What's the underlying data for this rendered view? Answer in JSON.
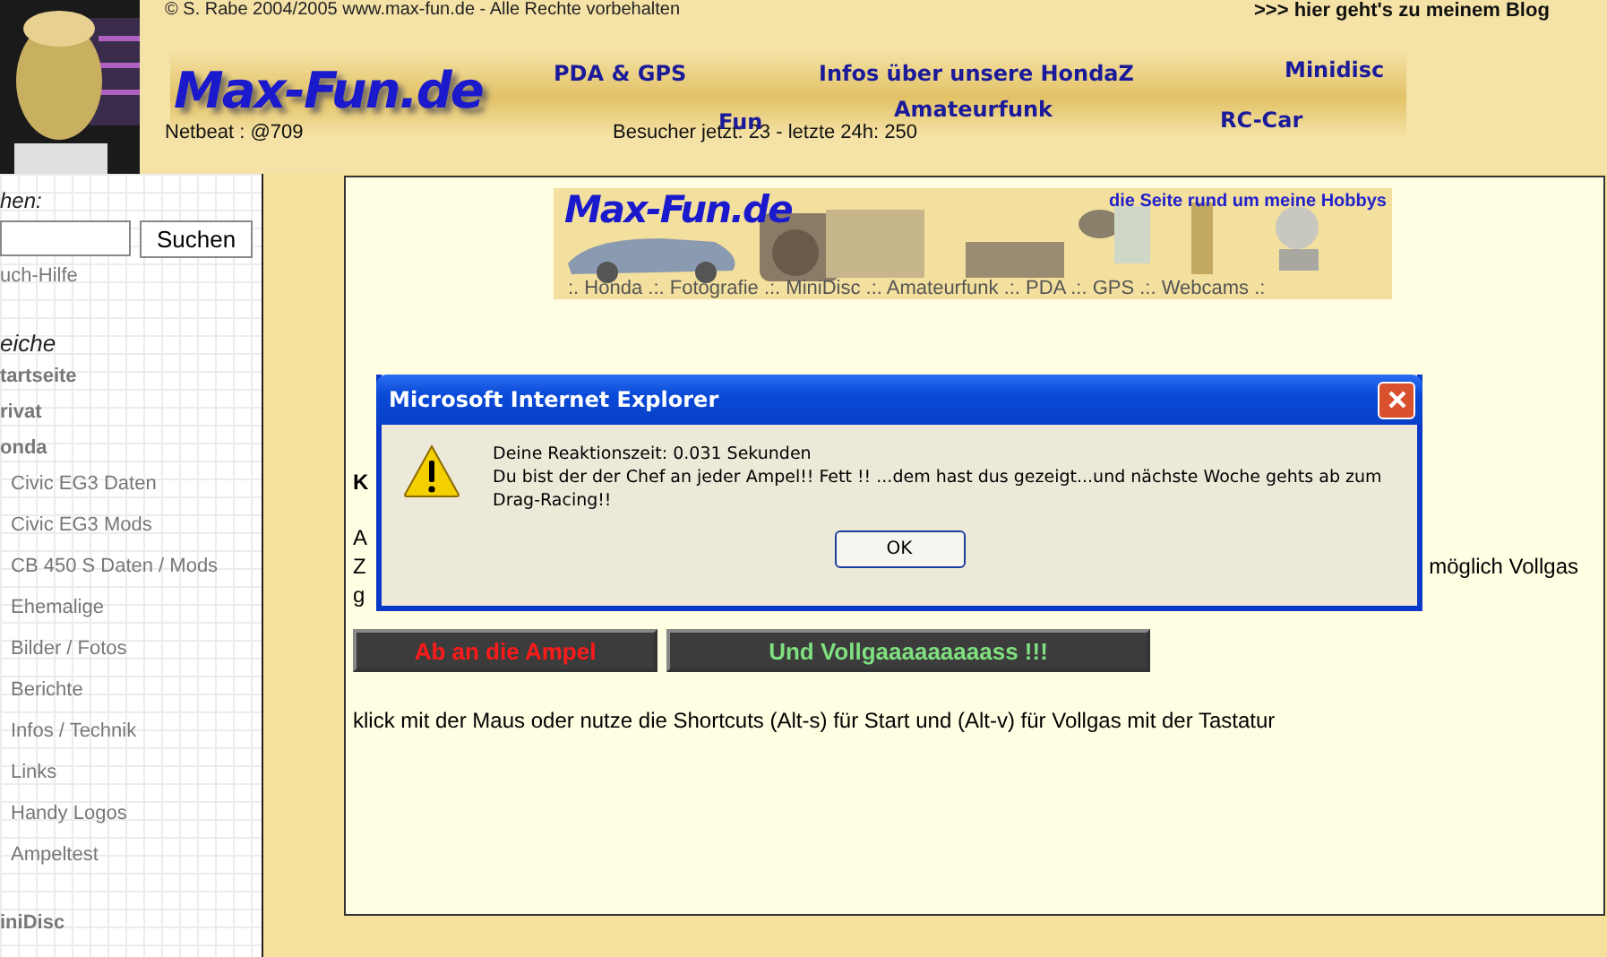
{
  "header": {
    "copyright": "© S. Rabe 2004/2005 www.max-fun.de - Alle Rechte vorbehalten",
    "blog_link": ">>> hier geht's zu meinem Blog",
    "logo": "Max-Fun.de",
    "counter": "Netbeat : @709",
    "visitors": "Besucher jetzt: 23 - letzte 24h: 250",
    "nav": [
      {
        "label": "PDA & GPS"
      },
      {
        "label": "Infos über unsere HondaZ"
      },
      {
        "label": "Minidisc"
      },
      {
        "label": "Fun"
      },
      {
        "label": "Amateurfunk"
      },
      {
        "label": "RC-Car"
      }
    ]
  },
  "sidebar": {
    "search_label": "hen:",
    "search_button": "Suchen",
    "search_help": "uch-Hilfe",
    "section_title": "eiche",
    "items": [
      {
        "label": "tartseite",
        "kind": "main"
      },
      {
        "label": "rivat",
        "kind": "main"
      },
      {
        "label": "onda",
        "kind": "main"
      },
      {
        "label": "Civic EG3 Daten",
        "kind": "sub"
      },
      {
        "label": "Civic EG3 Mods",
        "kind": "sub"
      },
      {
        "label": "CB 450 S Daten / Mods",
        "kind": "sub"
      },
      {
        "label": "Ehemalige",
        "kind": "sub"
      },
      {
        "label": "Bilder / Fotos",
        "kind": "sub"
      },
      {
        "label": "Berichte",
        "kind": "sub"
      },
      {
        "label": "Infos / Technik",
        "kind": "sub"
      },
      {
        "label": "Links",
        "kind": "sub"
      },
      {
        "label": "Handy Logos",
        "kind": "sub"
      },
      {
        "label": "Ampeltest",
        "kind": "sub"
      },
      {
        "label": "iniDisc",
        "kind": "section"
      }
    ]
  },
  "content": {
    "banner": {
      "logo": "Max-Fun.de",
      "tagline": "die Seite rund um meine Hobbys",
      "menu": ":. Honda .:. Fotografie .:. MiniDisc .:. Amateurfunk .:. PDA .:. GPS .:. Webcams .:"
    },
    "heading": "K",
    "lines": [
      {
        "left": "A"
      },
      {
        "left": "Z",
        "right": "möglich Vollgas"
      },
      {
        "left": "g"
      }
    ],
    "buttons": [
      {
        "label": "Ab an die Ampel",
        "kind": "start"
      },
      {
        "label": "Und Vollgaaaaaaaaass !!!",
        "kind": "go"
      }
    ],
    "hint": "klick mit der Maus oder nutze die Shortcuts (Alt-s) für Start und (Alt-v) für Vollgas mit der Tastatur"
  },
  "dialog": {
    "title": "Microsoft Internet Explorer",
    "lines": [
      "Deine Reaktionszeit: 0.031 Sekunden",
      "Du bist der der Chef an jeder Ampel!! Fett !! ...dem hast dus gezeigt...und nächste Woche gehts ab zum Drag-Racing!!"
    ],
    "ok": "OK"
  }
}
